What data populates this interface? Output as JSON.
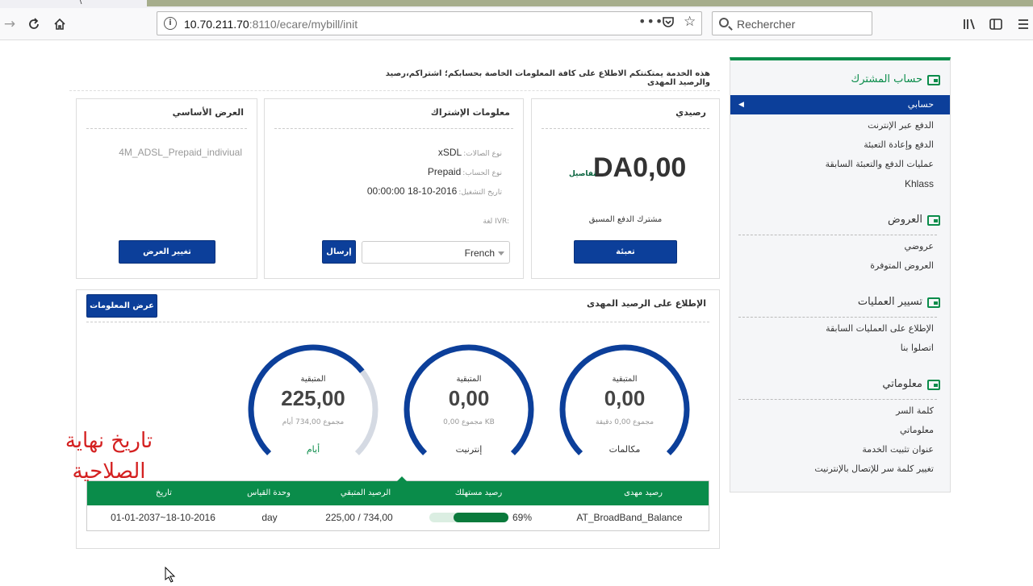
{
  "browser": {
    "tab_fragment": "\\",
    "url_host": "10.70.211.70",
    "url_rest": ":8110/ecare/mybill/init",
    "search_placeholder": "Rechercher"
  },
  "intro_text": "هذه الخدمة يمتكنتكم الاطلاع على كافة المعلومات الخاصة بحسابكم؛ اشتراكم،رصيد والرصيد المهدى",
  "balance_panel": {
    "title": "رصيدي",
    "amount": "DA0,00",
    "details_link": "تفاصيل",
    "subscriber_type": "مشترك الدفع المسبق",
    "recharge_button": "تعبئة"
  },
  "subscription_panel": {
    "title": "معلومات الإشتراك",
    "rows": [
      {
        "label": "نوع الصالات:",
        "value": "xSDL"
      },
      {
        "label": "نوع الحساب:",
        "value": "Prepaid"
      },
      {
        "label": "تاريخ التشغيل:",
        "value": "18-10-2016 00:00:00"
      }
    ],
    "ivr_label": "لغة IVR:",
    "ivr_value": "French",
    "send_button": "إرسال"
  },
  "offer_panel": {
    "title": "العرض الأساسي",
    "offer_name": "4M_ADSL_Prepaid_indiviual",
    "change_button": "تغيير العرض"
  },
  "gift_panel": {
    "title": "الإطلاع على الرصيد المهدى",
    "show_info_button": "عرض المعلومات",
    "gauges": [
      {
        "remaining_label": "المتبقية",
        "value": "0,00",
        "total": "مجموع 0,00 دقيقة",
        "name": "مكالمات",
        "fraction": 0.0
      },
      {
        "remaining_label": "المتبقية",
        "value": "0,00",
        "total": "مجموع 0,00 KB",
        "name": "إنترنيت",
        "fraction": 0.0
      },
      {
        "remaining_label": "المتبقية",
        "value": "225,00",
        "total": "مجموع 734,00 أيام",
        "name": "أيام",
        "fraction": 0.307
      }
    ],
    "table": {
      "headers": [
        "رصيد مهدى",
        "رصيد مستهلك",
        "الرصيد المتبقي",
        "وحدة القياس",
        "تاريخ"
      ],
      "row": {
        "name": "AT_BroadBand_Balance",
        "consumed_percent": "69%",
        "consumed_fraction": 0.69,
        "remaining": "225,00 / 734,00",
        "unit": "day",
        "dates": "18-10-2016~01-01-2037"
      }
    }
  },
  "overlay_annotation": {
    "line1": "تاريخ نهاية",
    "line2": "الصلاحية"
  },
  "sidebar": {
    "sections": [
      {
        "title": "حساب المشترك",
        "items": [
          "حسابي",
          "الدفع عبر الإنترنت",
          "الدفع وإعادة التعبئة",
          "عمليات الدفع والتعبئة السابقة",
          "Khlass"
        ]
      },
      {
        "title": "العروض",
        "items": [
          "عروضي",
          "العروض المتوفرة"
        ]
      },
      {
        "title": "تسيير العمليات",
        "items": [
          "الإطلاع على العمليات السابقة",
          "اتصلوا بنا"
        ]
      },
      {
        "title": "معلوماتي",
        "items": [
          "كلمة السر",
          "معلوماتي",
          "عنوان تثبيت الخدمة",
          "تغيير كلمة سر للإتصال بالإنترنيت"
        ]
      }
    ]
  },
  "colors": {
    "brand_green": "#0a8c4a",
    "brand_blue": "#0c3f9a",
    "gauge_blue": "#0c3f9a",
    "gauge_track": "#d5dae3"
  }
}
